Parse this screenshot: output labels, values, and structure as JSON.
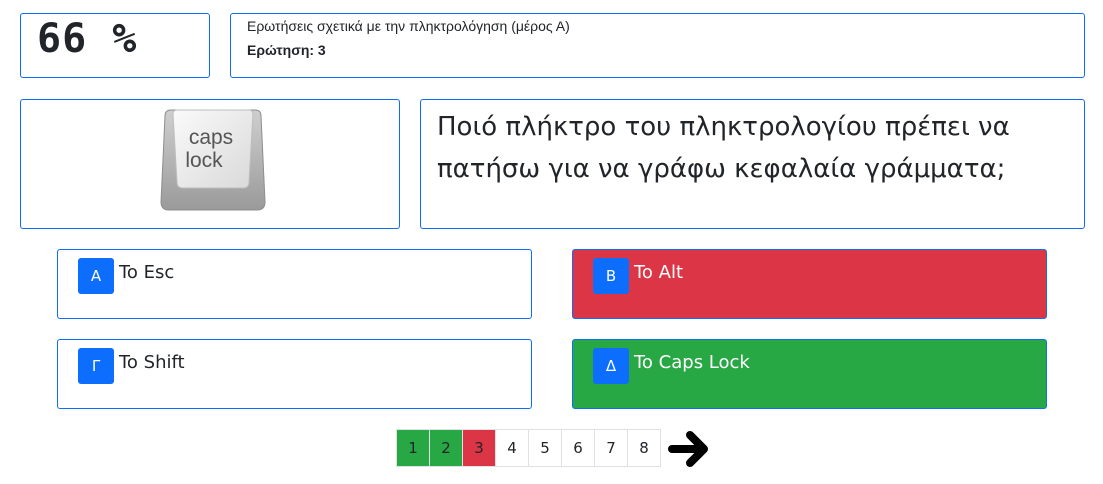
{
  "header": {
    "score": "66 %",
    "subject": "Ερωτήσεις σχετικά με την πληκτρολόγηση (μέρος Α)",
    "question_number": "Ερώτηση: 3"
  },
  "question": {
    "image_key_line1": "caps",
    "image_key_line2": "lock",
    "text": "Ποιό πλήκτρο του πληκτρολογίου πρέπει να πατήσω για να γράφω κεφαλαία γράμματα;"
  },
  "answers": [
    {
      "letter": "Α",
      "label": "To Esc",
      "state": "neutral"
    },
    {
      "letter": "Β",
      "label": "To Alt",
      "state": "wrong"
    },
    {
      "letter": "Γ",
      "label": "To Shift",
      "state": "neutral"
    },
    {
      "letter": "Δ",
      "label": "To Caps Lock",
      "state": "correct"
    }
  ],
  "pagination": {
    "pages": [
      "1",
      "2",
      "3",
      "4",
      "5",
      "6",
      "7",
      "8"
    ],
    "states": [
      "correct",
      "correct",
      "wrong",
      "unanswered",
      "unanswered",
      "unanswered",
      "unanswered",
      "unanswered"
    ],
    "next_icon": "arrow-right-icon"
  },
  "colors": {
    "accent": "#0d6efd",
    "correct": "#28a745",
    "wrong": "#dc3545"
  }
}
